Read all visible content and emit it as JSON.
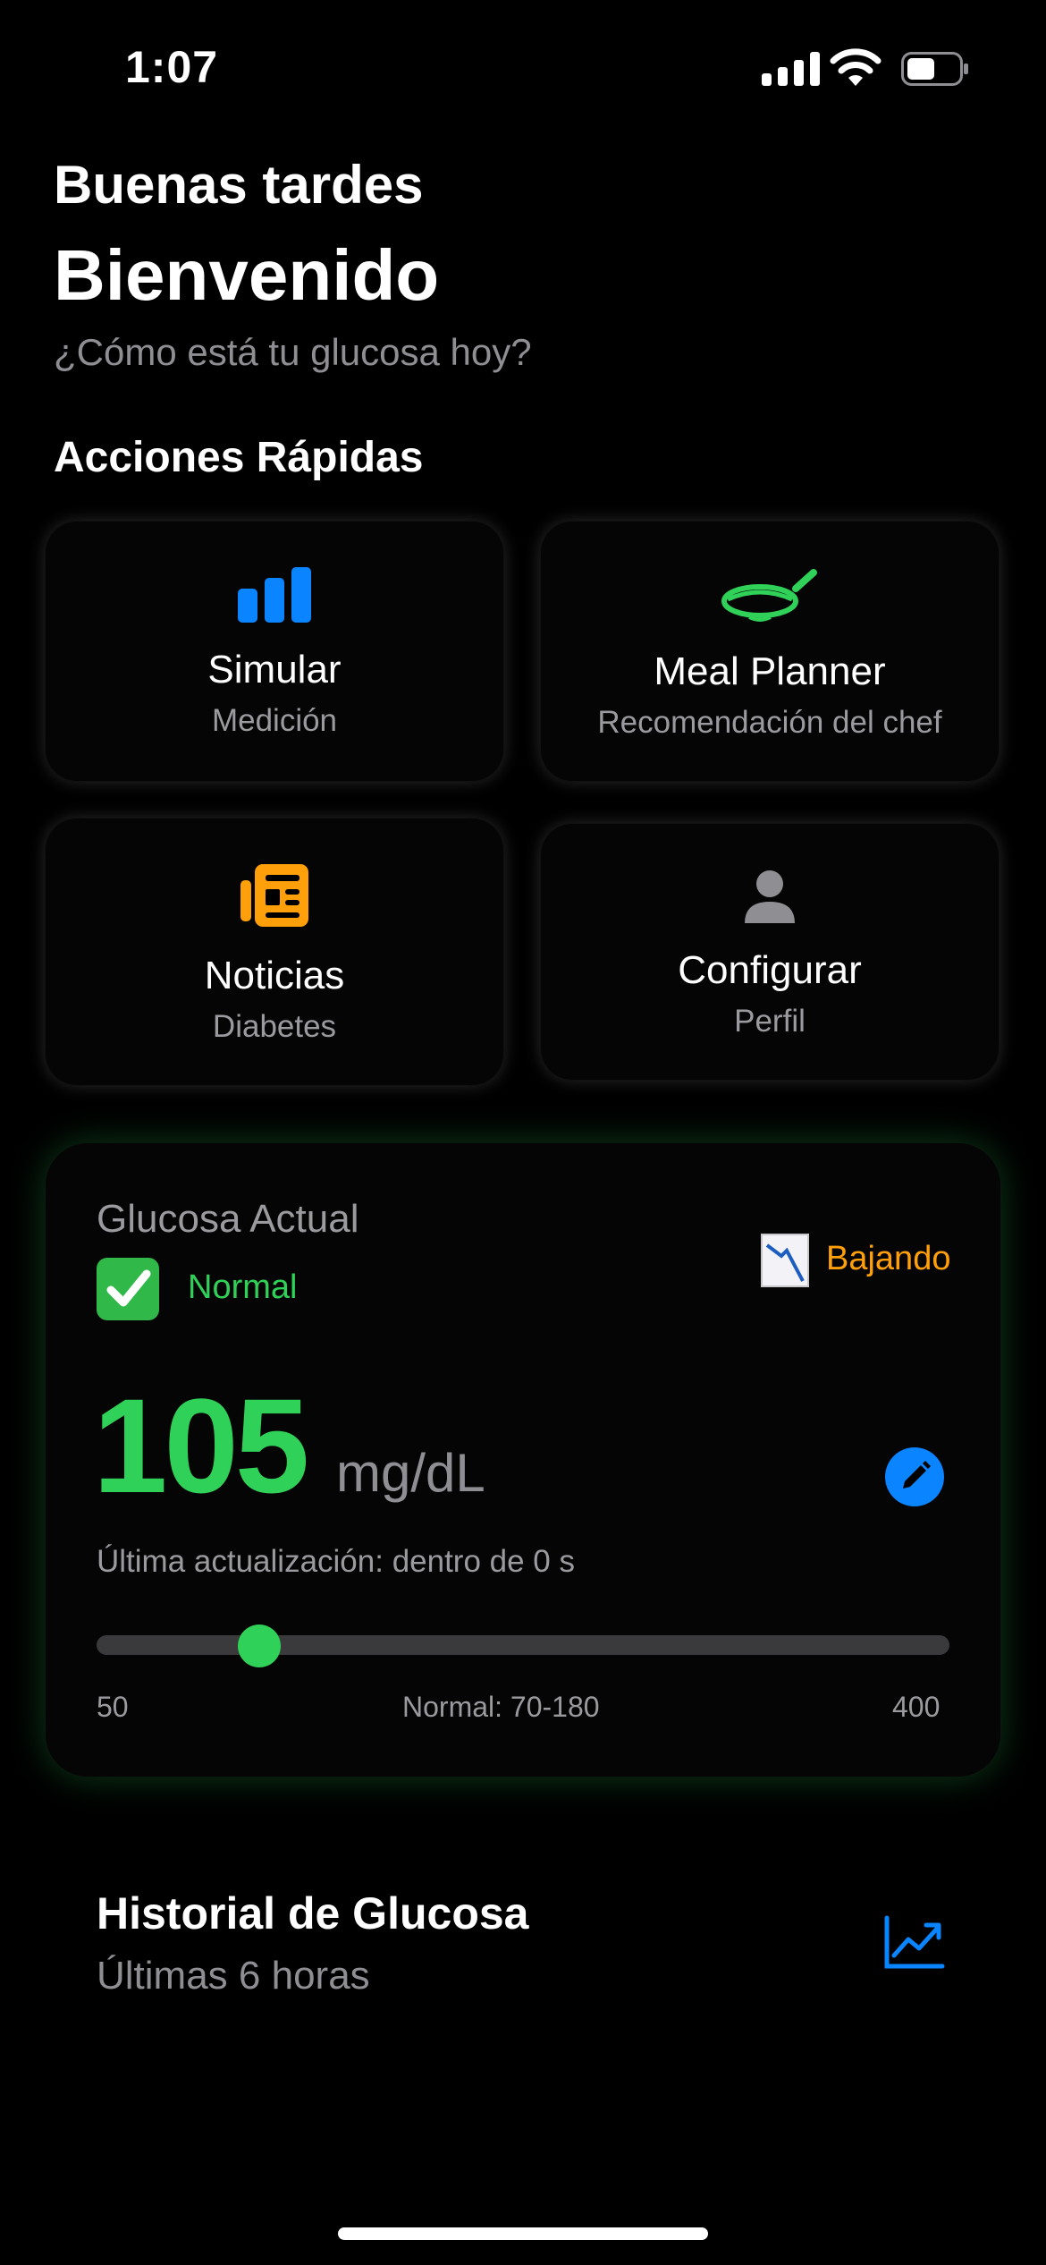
{
  "status_bar": {
    "time": "1:07"
  },
  "header": {
    "greeting": "Buenas tardes",
    "welcome": "Bienvenido",
    "subtitle": "¿Cómo está tu glucosa hoy?"
  },
  "quick_actions": {
    "title": "Acciones Rápidas",
    "items": [
      {
        "title": "Simular",
        "subtitle": "Medición",
        "icon": "bar-chart-icon",
        "color": "#0a84ff"
      },
      {
        "title": "Meal Planner",
        "subtitle": "Recomendación del chef",
        "icon": "frying-pan-icon",
        "color": "#30d158"
      },
      {
        "title": "Noticias",
        "subtitle": "Diabetes",
        "icon": "newspaper-icon",
        "color": "#ff9f0a"
      },
      {
        "title": "Configurar",
        "subtitle": "Perfil",
        "icon": "person-icon",
        "color": "#8e8e93"
      }
    ]
  },
  "glucose": {
    "label": "Glucosa Actual",
    "status": "Normal",
    "trend": "Bajando",
    "value": "105",
    "unit": "mg/dL",
    "updated": "Última actualización: dentro de 0 s",
    "range_min": "50",
    "range_normal": "Normal: 70-180",
    "range_max": "400",
    "slider_value": 105,
    "slider_min": 50,
    "slider_max": 400,
    "status_color": "#30d158",
    "trend_color": "#ff9f0a"
  },
  "history": {
    "title": "Historial de Glucosa",
    "subtitle": "Últimas 6 horas"
  }
}
